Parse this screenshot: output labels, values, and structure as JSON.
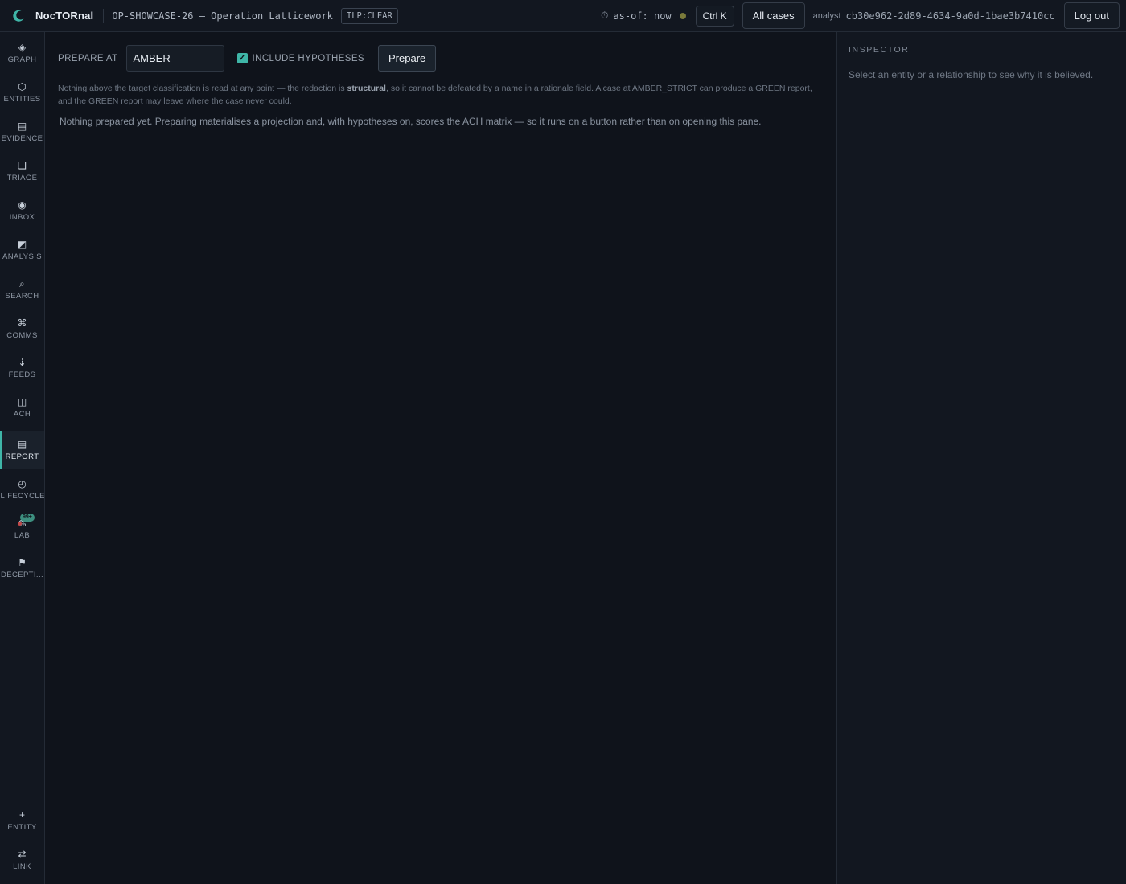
{
  "app": {
    "name": "NocTORnal",
    "case_title": "OP-SHOWCASE-26 — Operation Latticework",
    "tlp": "TLP:CLEAR"
  },
  "topbar": {
    "asof_label": "as-of: now",
    "ctrlk_label": "Ctrl K",
    "all_cases_label": "All cases",
    "analyst_label": "analyst",
    "analyst_id": "cb30e962-2d89-4634-9a0d-1bae3b7410cc",
    "logout_label": "Log out"
  },
  "sidebar": {
    "items": [
      {
        "label": "GRAPH",
        "icon": "◈",
        "icon_name": "graph-icon"
      },
      {
        "label": "ENTITIES",
        "icon": "⬡",
        "icon_name": "entities-icon"
      },
      {
        "label": "EVIDENCE",
        "icon": "▤",
        "icon_name": "evidence-icon"
      },
      {
        "label": "TRIAGE",
        "icon": "❏",
        "icon_name": "triage-icon"
      },
      {
        "label": "INBOX",
        "icon": "◉",
        "icon_name": "inbox-icon"
      },
      {
        "label": "ANALYSIS",
        "icon": "◩",
        "icon_name": "analysis-icon"
      },
      {
        "label": "SEARCH",
        "icon": "⌕",
        "icon_name": "search-icon"
      },
      {
        "label": "COMMS",
        "icon": "⌘",
        "icon_name": "comms-icon"
      },
      {
        "label": "FEEDS",
        "icon": "⇣",
        "icon_name": "feeds-icon"
      },
      {
        "label": "ACH",
        "icon": "◫",
        "icon_name": "ach-icon"
      },
      {
        "label": "REPORT",
        "icon": "▤",
        "icon_name": "report-icon",
        "active": true
      },
      {
        "label": "LIFECYCLE",
        "icon": "◴",
        "icon_name": "lifecycle-icon"
      },
      {
        "label": "LAB",
        "icon": "⚗",
        "icon_name": "lab-icon",
        "badge": "99+"
      },
      {
        "label": "DECEPTI...",
        "icon": "⚑",
        "icon_name": "deception-icon"
      }
    ],
    "bottom_items": [
      {
        "label": "ENTITY",
        "icon": "+",
        "icon_name": "add-entity-icon"
      },
      {
        "label": "LINK",
        "icon": "⇄",
        "icon_name": "link-icon"
      }
    ]
  },
  "report": {
    "prepare_at_label": "PREPARE AT",
    "classification_value": "AMBER",
    "include_hypotheses_label": "INCLUDE HYPOTHESES",
    "include_hypotheses_checked": true,
    "prepare_button": "Prepare",
    "note_pre": "Nothing above the target classification is read at any point — the redaction is ",
    "note_bold": "structural",
    "note_post": ", so it cannot be defeated by a name in a rationale field. A case at AMBER_STRICT can produce a GREEN report, and the GREEN report may leave where the case never could.",
    "empty_message": "Nothing prepared yet. Preparing materialises a projection and, with hypotheses on, scores the ACH matrix — so it runs on a button rather than on opening this pane."
  },
  "inspector": {
    "title": "INSPECTOR",
    "message": "Select an entity or a relationship to see why it is believed."
  },
  "colors": {
    "accent": "#3fb6a8",
    "background": "#0f131b",
    "panel": "#121720"
  }
}
